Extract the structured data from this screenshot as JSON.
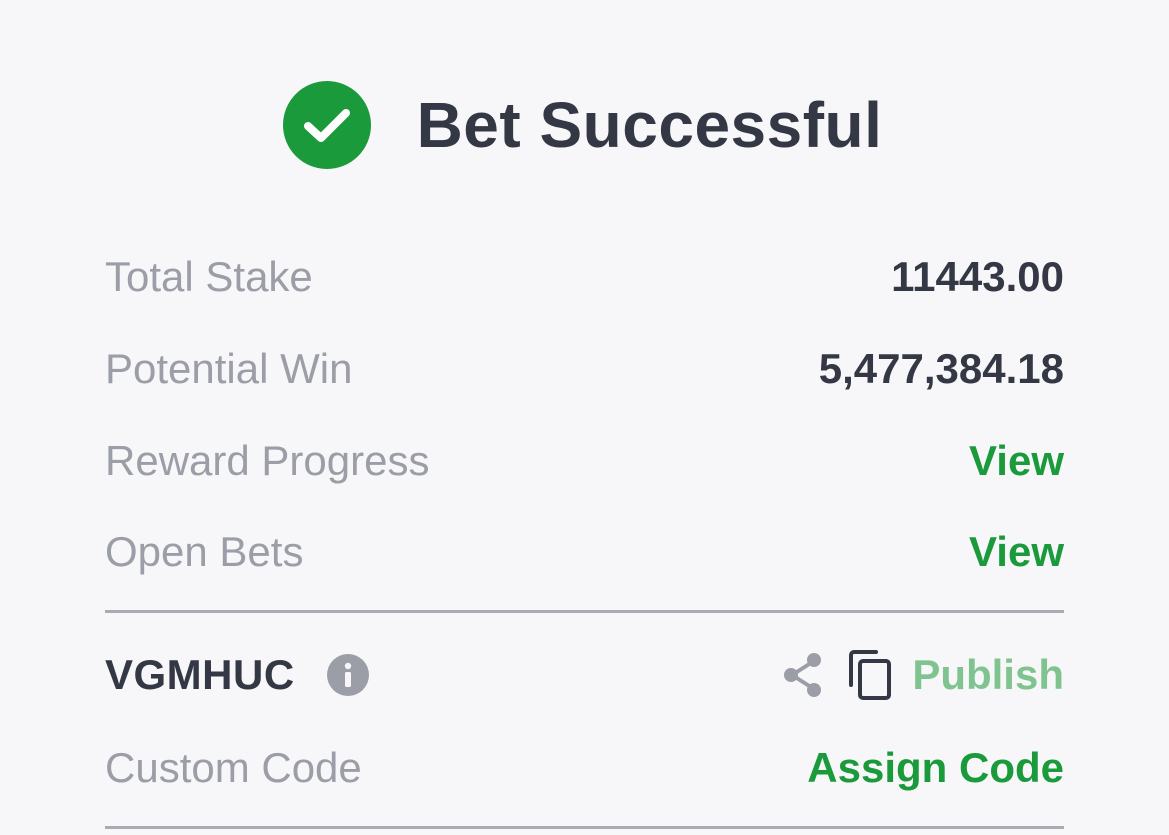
{
  "header": {
    "title": "Bet Successful",
    "icon": "check-circle-icon",
    "icon_color": "#1b9a3c"
  },
  "summary": {
    "total_stake_label": "Total Stake",
    "total_stake_value": "11443.00",
    "potential_win_label": "Potential Win",
    "potential_win_value": "5,477,384.18",
    "reward_progress_label": "Reward Progress",
    "reward_progress_action": "View",
    "open_bets_label": "Open Bets",
    "open_bets_action": "View"
  },
  "booking": {
    "code": "VGMHUC",
    "info_icon": "info-icon",
    "share_icon": "share-icon",
    "copy_icon": "copy-icon",
    "publish_label": "Publish",
    "custom_code_label": "Custom Code",
    "assign_code_label": "Assign Code"
  },
  "colors": {
    "accent": "#1b9a3c",
    "accent_disabled": "#7fc48f",
    "text_dark": "#333844",
    "text_muted": "#9b9ea7",
    "background": "#f7f7f9"
  }
}
